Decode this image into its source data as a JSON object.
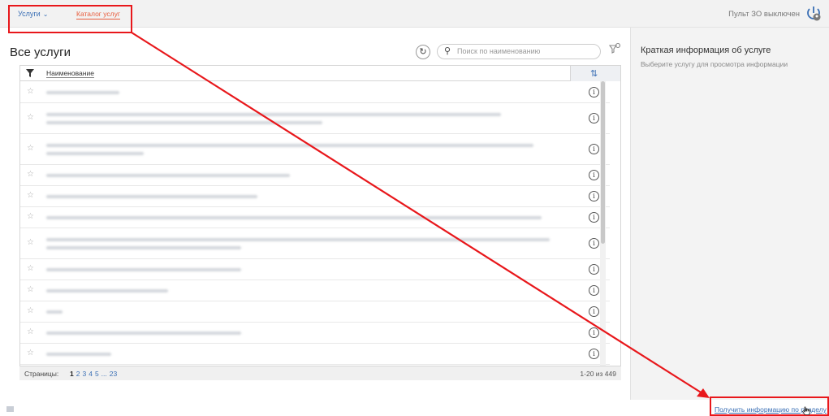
{
  "topbar": {
    "services_menu": "Услуги",
    "catalog_tab": "Каталог услуг",
    "pult_status": "Пульт ЗО выключен"
  },
  "main": {
    "title": "Все услуги",
    "search_placeholder": "Поиск по наименованию",
    "column_name": "Наименование",
    "rows": [
      {
        "lines": 1
      },
      {
        "lines": 2
      },
      {
        "lines": 2
      },
      {
        "lines": 1
      },
      {
        "lines": 1
      },
      {
        "lines": 1
      },
      {
        "lines": 2
      },
      {
        "lines": 1
      },
      {
        "lines": 1
      },
      {
        "lines": 1
      },
      {
        "lines": 1
      },
      {
        "lines": 1
      }
    ],
    "pager": {
      "label": "Страницы:",
      "pages": [
        "1",
        "2",
        "3",
        "4",
        "5",
        "...",
        "23"
      ],
      "current": "1",
      "range": "1-20 из 449"
    }
  },
  "side": {
    "title": "Краткая информация об услуге",
    "hint": "Выберите услугу для просмотра информации"
  },
  "footer": {
    "link": "Получить информацию по разделу"
  },
  "colors": {
    "accent": "#3a6fb5",
    "annotation": "#e8171b",
    "active_tab": "#e85b3b"
  },
  "icons": [
    "chevron-down-icon",
    "power-person-icon",
    "refresh-icon",
    "search-icon",
    "funnel-icon",
    "column-settings-icon",
    "star-icon",
    "info-icon"
  ]
}
